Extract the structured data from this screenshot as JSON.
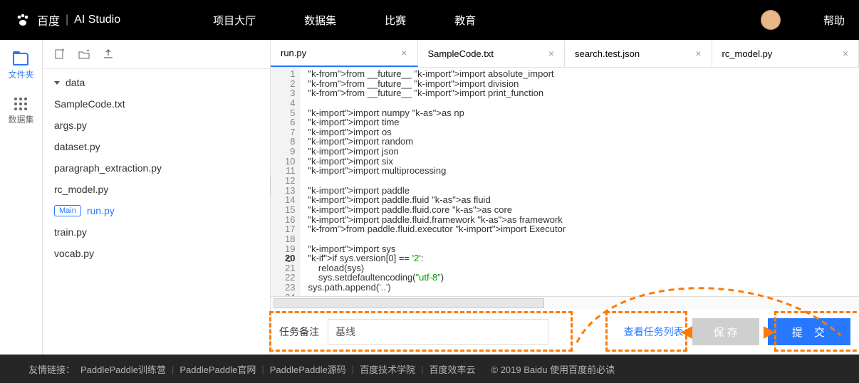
{
  "header": {
    "brand": "百度",
    "studio": "AI Studio",
    "nav": [
      "项目大厅",
      "数据集",
      "比赛",
      "教育"
    ],
    "help": "帮助"
  },
  "rail": {
    "files": "文件夹",
    "datasets": "数据集"
  },
  "tree": {
    "folder": "data",
    "files": [
      "SampleCode.txt",
      "args.py",
      "dataset.py",
      "paragraph_extraction.py",
      "rc_model.py"
    ],
    "main_badge": "Main",
    "main_file": "run.py",
    "rest": [
      "train.py",
      "vocab.py"
    ]
  },
  "tabs": [
    {
      "name": "run.py",
      "active": true
    },
    {
      "name": "SampleCode.txt",
      "active": false
    },
    {
      "name": "search.test.json",
      "active": false
    },
    {
      "name": "rc_model.py",
      "active": false
    }
  ],
  "code": {
    "lines": [
      "from __future__ import absolute_import",
      "from __future__ import division",
      "from __future__ import print_function",
      "",
      "import numpy as np",
      "import time",
      "import os",
      "import random",
      "import json",
      "import six",
      "import multiprocessing",
      "",
      "import paddle",
      "import paddle.fluid as fluid",
      "import paddle.fluid.core as core",
      "import paddle.fluid.framework as framework",
      "from paddle.fluid.executor import Executor",
      "",
      "import sys",
      "if sys.version[0] == '2':",
      "    reload(sys)",
      "    sys.setdefaultencoding(\"utf-8\")",
      "sys.path.append('..')",
      ""
    ]
  },
  "bottom": {
    "task_label": "任务备注",
    "task_value": "基线",
    "view_tasks": "查看任务列表",
    "save": "保 存",
    "submit": "提 交"
  },
  "footer": {
    "label": "友情链接：",
    "links": [
      "PaddlePaddle训练营",
      "PaddlePaddle官网",
      "PaddlePaddle源码",
      "百度技术学院",
      "百度效率云"
    ],
    "copyright": "© 2019 Baidu 使用百度前必读"
  }
}
